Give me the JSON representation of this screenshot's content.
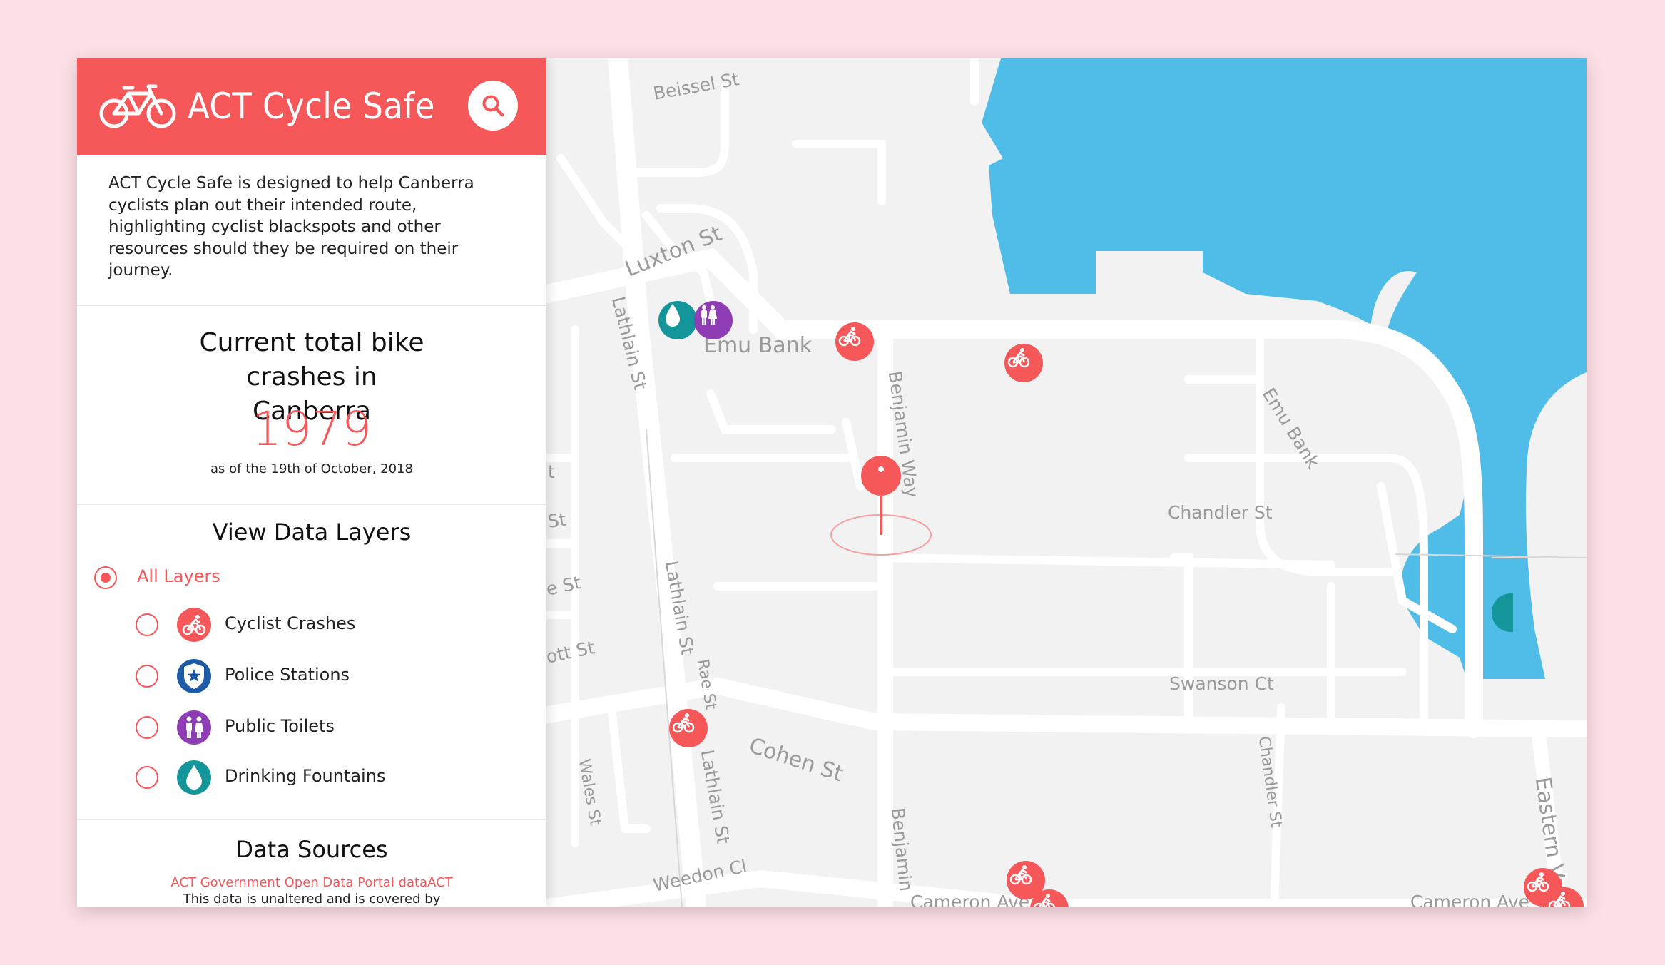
{
  "app": {
    "title": "ACT Cycle Safe",
    "brand_color": "#f6585a",
    "logo_icon": "bicycle-icon",
    "search_icon": "search-icon"
  },
  "intro": "ACT Cycle Safe is designed to help Canberra cyclists plan out their intended route, highlighting cyclist blackspots and other resources should they be required on their journey.",
  "stats": {
    "title": "Current total bike crashes in Canberra",
    "count": "1979",
    "date": "as of the 19th of October, 2018"
  },
  "layers": {
    "title": "View Data Layers",
    "all": {
      "label": "All Layers",
      "checked": true
    },
    "items": [
      {
        "label": "Cyclist Crashes",
        "icon": "cyclist-icon",
        "color": "#f6585a",
        "checked": false
      },
      {
        "label": "Police Stations",
        "icon": "police-star-icon",
        "color": "#1d5aa5",
        "checked": false
      },
      {
        "label": "Public Toilets",
        "icon": "toilet-icon",
        "color": "#8e3db5",
        "checked": false
      },
      {
        "label": "Drinking Fountains",
        "icon": "water-drop-icon",
        "color": "#13959a",
        "checked": false
      }
    ]
  },
  "sources": {
    "title": "Data Sources",
    "link": "ACT Government Open Data Portal dataACT",
    "note": "This data is unaltered and is covered by"
  },
  "map": {
    "water_color": "#50bde9",
    "land_color": "#f2f2f2",
    "road_color": "#ffffff",
    "streets": {
      "beissel": "Beissel St",
      "luxton": "Luxton St",
      "emu_bank_place": "Emu Bank",
      "lathlain_1": "Lathlain St",
      "lathlain_2": "Lathlain St",
      "lathlain_3": "Lathlain St",
      "benjamin_1": "Benjamin Way",
      "benjamin_2": "Benjamin",
      "emu_bank_road": "Emu Bank",
      "chandler_1": "Chandler St",
      "chandler_2": "Chandler St",
      "swanson": "Swanson Ct",
      "cohen": "Cohen St",
      "rae": "Rae St",
      "wales": "Wales St",
      "weedon": "Weedon Cl",
      "cameron_1": "Cameron Ave",
      "cameron_2": "Cameron Ave",
      "eastern": "Eastern Vall",
      "frag_t": "t",
      "frag_st": "St",
      "frag_est": "e St",
      "frag_ott": "ott St"
    }
  }
}
